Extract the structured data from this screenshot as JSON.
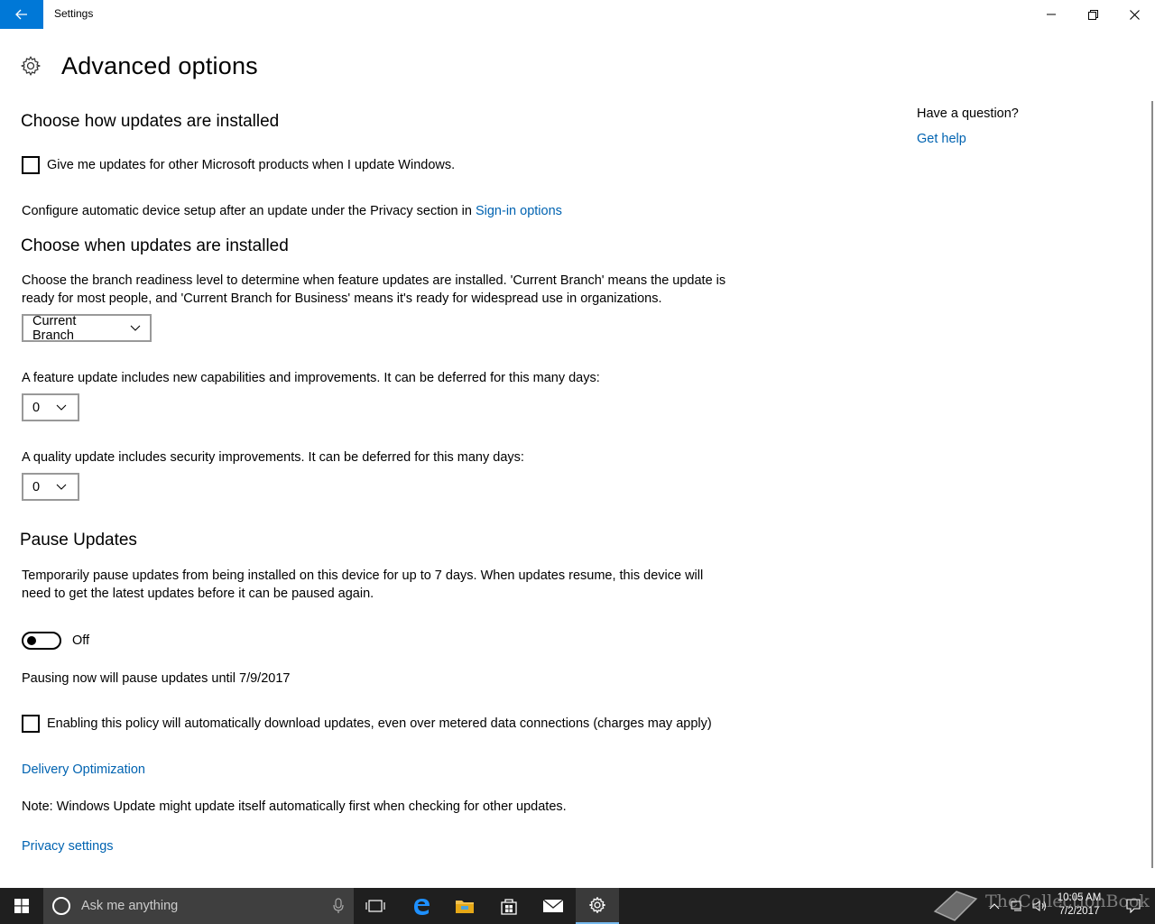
{
  "window": {
    "app_title": "Settings",
    "controls": [
      "minimize",
      "maximize",
      "close"
    ]
  },
  "header": {
    "page_title": "Advanced options",
    "icon": "gear-icon"
  },
  "section_install": {
    "heading": "Choose how updates are installed",
    "checkbox_label": "Give me updates for other Microsoft products when I update Windows.",
    "checkbox_checked": false,
    "signin_text": "Configure automatic device setup after an update under the Privacy section in",
    "signin_link": "Sign-in options"
  },
  "section_when": {
    "heading": "Choose when updates are installed",
    "branch_desc_line1": "Choose the branch readiness level to determine when feature updates are installed. 'Current Branch' means the update is",
    "branch_desc_line2": "ready for most people, and 'Current Branch for Business' means it's ready for widespread use in organizations.",
    "branch_select": "Current Branch",
    "feature_desc": "A feature update includes new capabilities and improvements. It can be deferred for this many days:",
    "feature_days": "0",
    "quality_desc": "A quality update includes security improvements. It can be deferred for this many days:",
    "quality_days": "0"
  },
  "section_pause": {
    "heading": "Pause Updates",
    "desc_line1": "Temporarily pause updates from being installed on this device for up to 7 days. When updates resume, this device will",
    "desc_line2": "need to get the latest updates before it can be paused again.",
    "toggle_state": "Off",
    "pause_until": "Pausing now will pause updates until 7/9/2017",
    "metered_label": "Enabling this policy will automatically download updates, even over metered data connections (charges may apply)",
    "metered_checked": false
  },
  "links": {
    "delivery": "Delivery Optimization",
    "note": "Note: Windows Update might update itself automatically first when checking for other updates.",
    "privacy": "Privacy settings"
  },
  "help": {
    "question": "Have a question?",
    "link": "Get help"
  },
  "taskbar": {
    "search_placeholder": "Ask me anything",
    "time": "10:05 AM",
    "date": "7/2/2017",
    "pinned": [
      "task-view-icon",
      "edge-icon",
      "file-explorer-icon",
      "store-icon",
      "mail-icon",
      "settings-icon"
    ],
    "accent": "#0078d7"
  },
  "watermark": "TheCollectionBook"
}
